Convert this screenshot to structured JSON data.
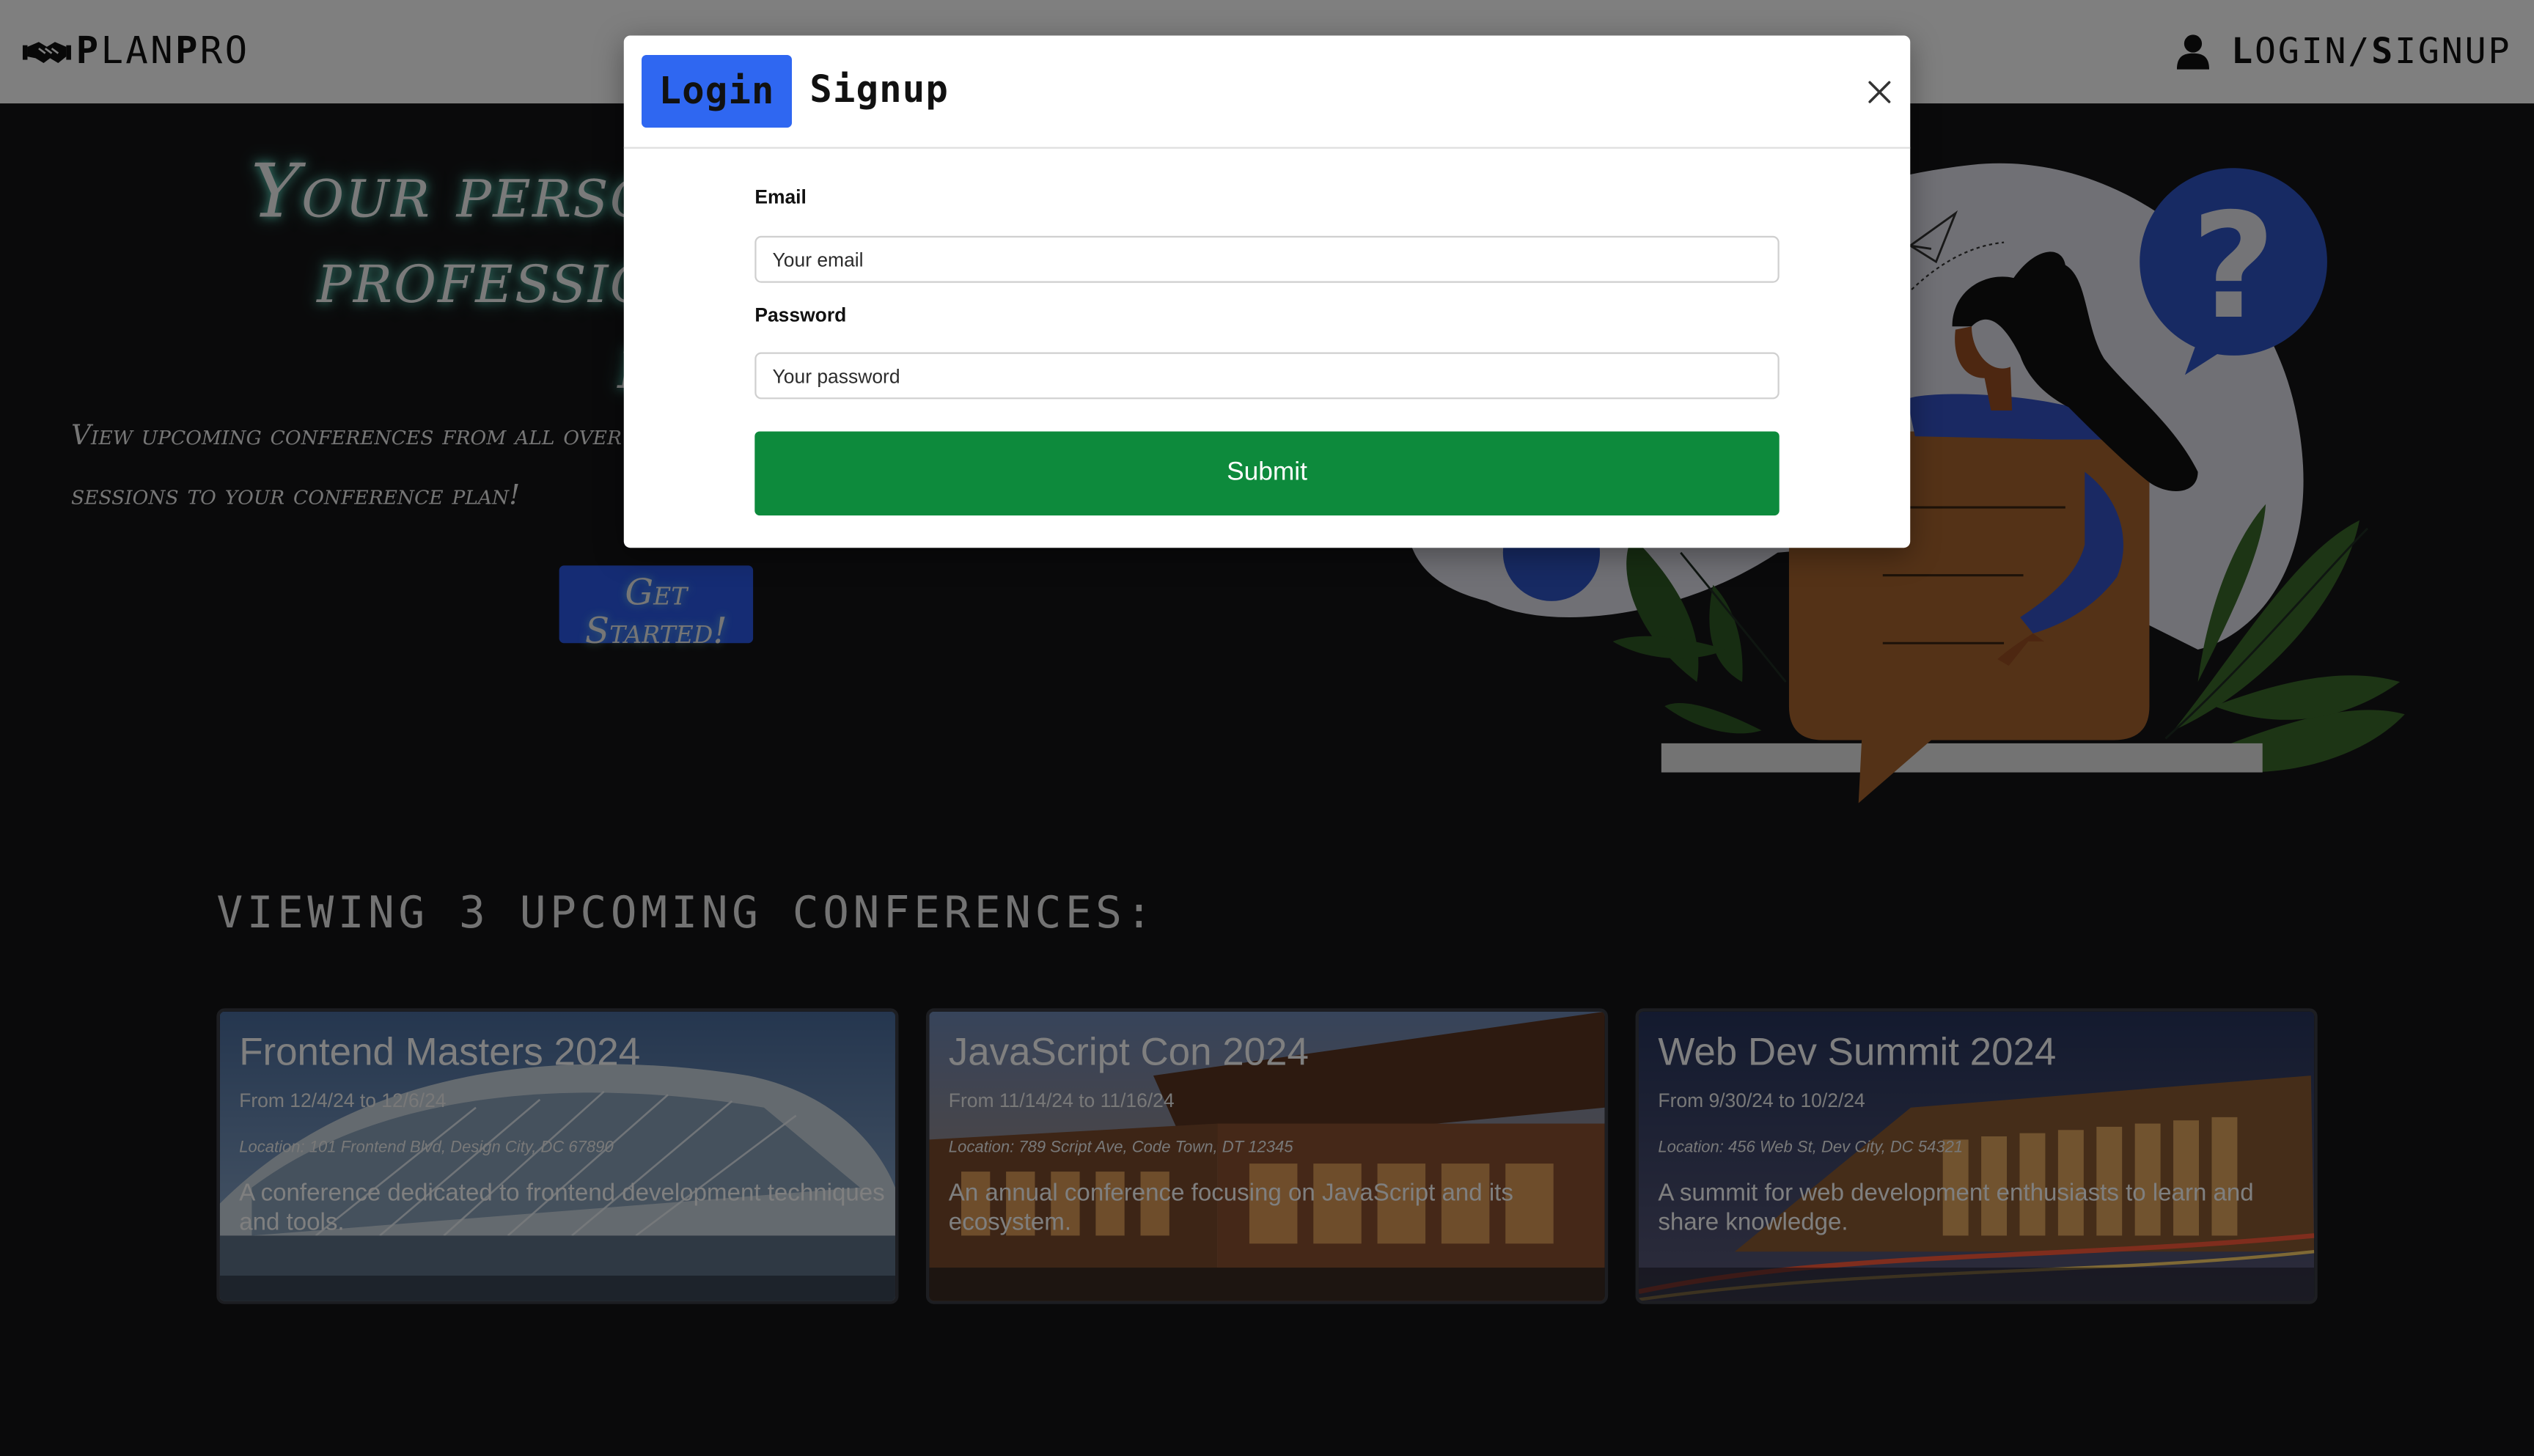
{
  "colors": {
    "page_bg": "#151517",
    "accent_blue": "#2f67f1",
    "submit_green": "#0d8a3c",
    "hero_glow": "#7affe6"
  },
  "navbar": {
    "brand_icon": "handshake-icon",
    "brand_name_prefix": "P",
    "brand_name_mid": "LAN",
    "brand_name_p2": "P",
    "brand_name_suffix": "RO",
    "user_icon": "user-icon",
    "login_l": "L",
    "login_rest": "OGIN/",
    "signup_s": "S",
    "signup_rest": "IGNUP"
  },
  "hero": {
    "title_line1": "Your personal",
    "title_line2": "professional",
    "title_line3": "plan",
    "subtitle_line1": "View upcoming conferences from all over",
    "subtitle_line2": "sessions to your conference plan!",
    "cta_line1": "Get",
    "cta_line2": "Started!"
  },
  "conferences": {
    "heading": "VIEWING 3 UPCOMING CONFERENCES:",
    "items": [
      {
        "title": "Frontend Masters 2024",
        "dates": "From 12/4/24 to 12/6/24",
        "location": "Location: 101 Frontend Blvd, Design City, DC 67890",
        "description": "A conference dedicated to frontend development techniques and tools."
      },
      {
        "title": "JavaScript Con 2024",
        "dates": "From 11/14/24 to 11/16/24",
        "location": "Location: 789 Script Ave, Code Town, DT 12345",
        "description": "An annual conference focusing on JavaScript and its ecosystem."
      },
      {
        "title": "Web Dev Summit 2024",
        "dates": "From 9/30/24 to 10/2/24",
        "location": "Location: 456 Web St, Dev City, DC 54321",
        "description": "A summit for web development enthusiasts to learn and share knowledge."
      }
    ]
  },
  "modal": {
    "tab_login": "Login",
    "tab_signup": "Signup",
    "close_icon": "close-icon",
    "email_label": "Email",
    "email_placeholder": "Your email",
    "password_label": "Password",
    "password_placeholder": "Your password",
    "submit_label": "Submit"
  }
}
